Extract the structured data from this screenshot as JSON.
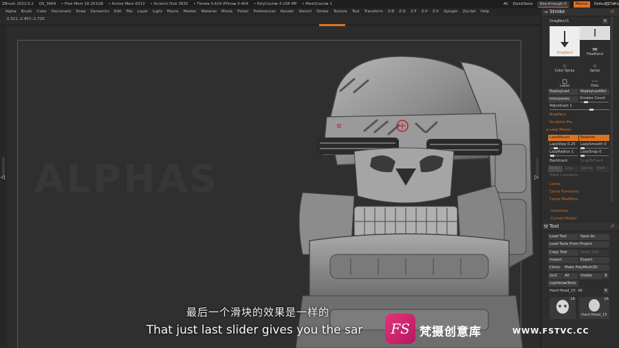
{
  "titlebar": {
    "app": "ZBrush 2022.0.2",
    "project": "QS_3664",
    "free_mem": "• Free Mem 18.261GB",
    "active_mem": "• Active Mem 6313",
    "scratch": "• Scratch Disk 3835",
    "timer": "• Timer▸ 0.624 ATime▸ 0.404",
    "polycount": "• PolyCount▸ 4.158 MP",
    "meshcount": "• MeshCount▸ 1",
    "ac": "AC",
    "quicksave": "QuickSave",
    "see_through": "See-through 0",
    "menus": "Menus",
    "zscript": "DefaultZScript",
    "win_controls": [
      "–",
      "□",
      "✕"
    ]
  },
  "menubar": {
    "items": [
      "Alpha",
      "Brush",
      "Color",
      "Document",
      "Draw",
      "Dynamics",
      "Edit",
      "File",
      "Layer",
      "Light",
      "Macro",
      "Marker",
      "Material",
      "Movie",
      "Picker",
      "Preferences",
      "Render",
      "Stencil",
      "Stroke",
      "Texture",
      "Tool",
      "Transform",
      "Z-B",
      "Z-D",
      "Z-F",
      "Z-P",
      "Z-X",
      "Zplugin",
      "Zscript",
      "Help"
    ]
  },
  "viewport": {
    "coords": "0.311,-2.457,-1.725",
    "watermark_text": "ALPHAS"
  },
  "stroke_panel": {
    "title": "Stroke",
    "dragrect_label": "DragRect",
    "dragrect_value": "1",
    "dragrect_r": "R",
    "stroke_types": [
      {
        "label": "DragRect"
      },
      {
        "label": "FreeHand"
      },
      {
        "label": "Color Spray"
      },
      {
        "label": "Spray"
      },
      {
        "label": "Lasso"
      },
      {
        "label": "Dots"
      }
    ],
    "replay_last": "ReplayLast",
    "replay_last_rel": "ReplayLastRel",
    "interpolate": "Interpolate",
    "strokes_count": "Strokes Count",
    "adjust_last": "AdjustLast 1",
    "modifiers": "Modifiers",
    "sculptris_pro": "Sculptris Pro",
    "lazy_mouse_header": "▸ Lazy Mouse",
    "lazy_mouse": "LazyMouse",
    "relative": "Relative",
    "lazy_step": "LazyStep 0.25",
    "lazy_smooth": "LazySmooth 0",
    "lazy_radius": "LazyRadius 1",
    "lazy_snap": "LazySnap 0",
    "backtrack": "Backtrack",
    "snap_to_track": "SnapToTrack",
    "plane": "Plane",
    "line": "Line",
    "spline": "Spline",
    "path": "Path",
    "track_curvature": "Track Curvature",
    "curve": "Curve",
    "curve_functions": "Curve Functions",
    "curve_modifiers": "Curve Modifiers",
    "inventory": "Inventory",
    "curves_helper": "Curves Helper"
  },
  "tool_panel": {
    "title": "Tool",
    "load_tool": "Load Tool",
    "save_as": "Save As",
    "load_from_project": "Load Tools From Project",
    "copy_tool": "Copy Tool",
    "paste_tool": "Paste Tool",
    "import": "Import",
    "export": "Export",
    "clone": "Clone",
    "make_polymesh": "Make PolyMesh3D",
    "goz": "GoZ",
    "all": "All",
    "visible": "Visible",
    "r": "R",
    "lightbox_tools": "Lightbox▸Tools",
    "current_tool": "Hard Head_15. 49",
    "thumbs": [
      {
        "count": "16"
      },
      {
        "count": "16",
        "label": "Hard Head_15"
      }
    ]
  },
  "subtitles": {
    "zh": "最后一个滑块的效果是一样的",
    "en": "That just last slider gives you the sar"
  },
  "watermark": {
    "logo": "FS",
    "brand": "梵摄创意库",
    "url": "WWW.FSTVC.CC"
  },
  "colors": {
    "accent": "#e0721f",
    "panel": "#2d2d2d",
    "button": "#3e3e3e",
    "logo": "#d22a72"
  }
}
